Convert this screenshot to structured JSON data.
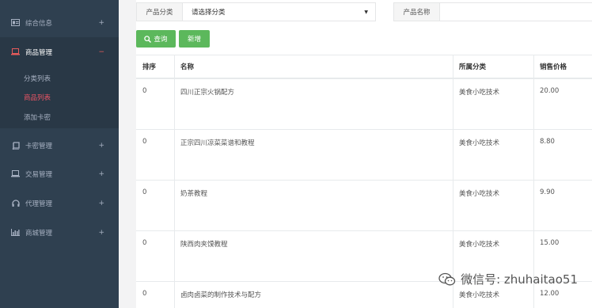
{
  "sidebar": {
    "items": [
      {
        "label": "综合信息",
        "toggle": "+",
        "icon": "id-card-icon"
      },
      {
        "label": "商品管理",
        "toggle": "−",
        "icon": "laptop-icon"
      },
      {
        "label": "卡密管理",
        "toggle": "+",
        "icon": "book-icon"
      },
      {
        "label": "交易管理",
        "toggle": "+",
        "icon": "monitor-icon"
      },
      {
        "label": "代理管理",
        "toggle": "+",
        "icon": "headphones-icon"
      },
      {
        "label": "商城管理",
        "toggle": "+",
        "icon": "bar-chart-icon"
      }
    ],
    "sub_items": [
      "分类列表",
      "商品列表",
      "添加卡密"
    ],
    "active_sub": "商品列表"
  },
  "filters": {
    "category_label": "产品分类",
    "category_value": "请选择分类",
    "name_label": "产品名称"
  },
  "buttons": {
    "search": "查询",
    "add": "新增",
    "color": "#5cb85c"
  },
  "table": {
    "headers": [
      "排序",
      "名称",
      "所属分类",
      "销售价格"
    ],
    "rows": [
      {
        "sort": "0",
        "name": "四川正宗火锅配方",
        "category": "美食小吃技术",
        "price": "20.00"
      },
      {
        "sort": "0",
        "name": "正宗四川凉菜菜谱和教程",
        "category": "美食小吃技术",
        "price": "8.80"
      },
      {
        "sort": "0",
        "name": "奶茶教程",
        "category": "美食小吃技术",
        "price": "9.90"
      },
      {
        "sort": "0",
        "name": "陕西肉夹馍教程",
        "category": "美食小吃技术",
        "price": "15.00"
      },
      {
        "sort": "0",
        "name": "卤肉卤菜的制作技术与配方",
        "category": "美食小吃技术",
        "price": "12.00"
      }
    ]
  },
  "watermark": {
    "text": "微信号: zhuhaitao51"
  }
}
